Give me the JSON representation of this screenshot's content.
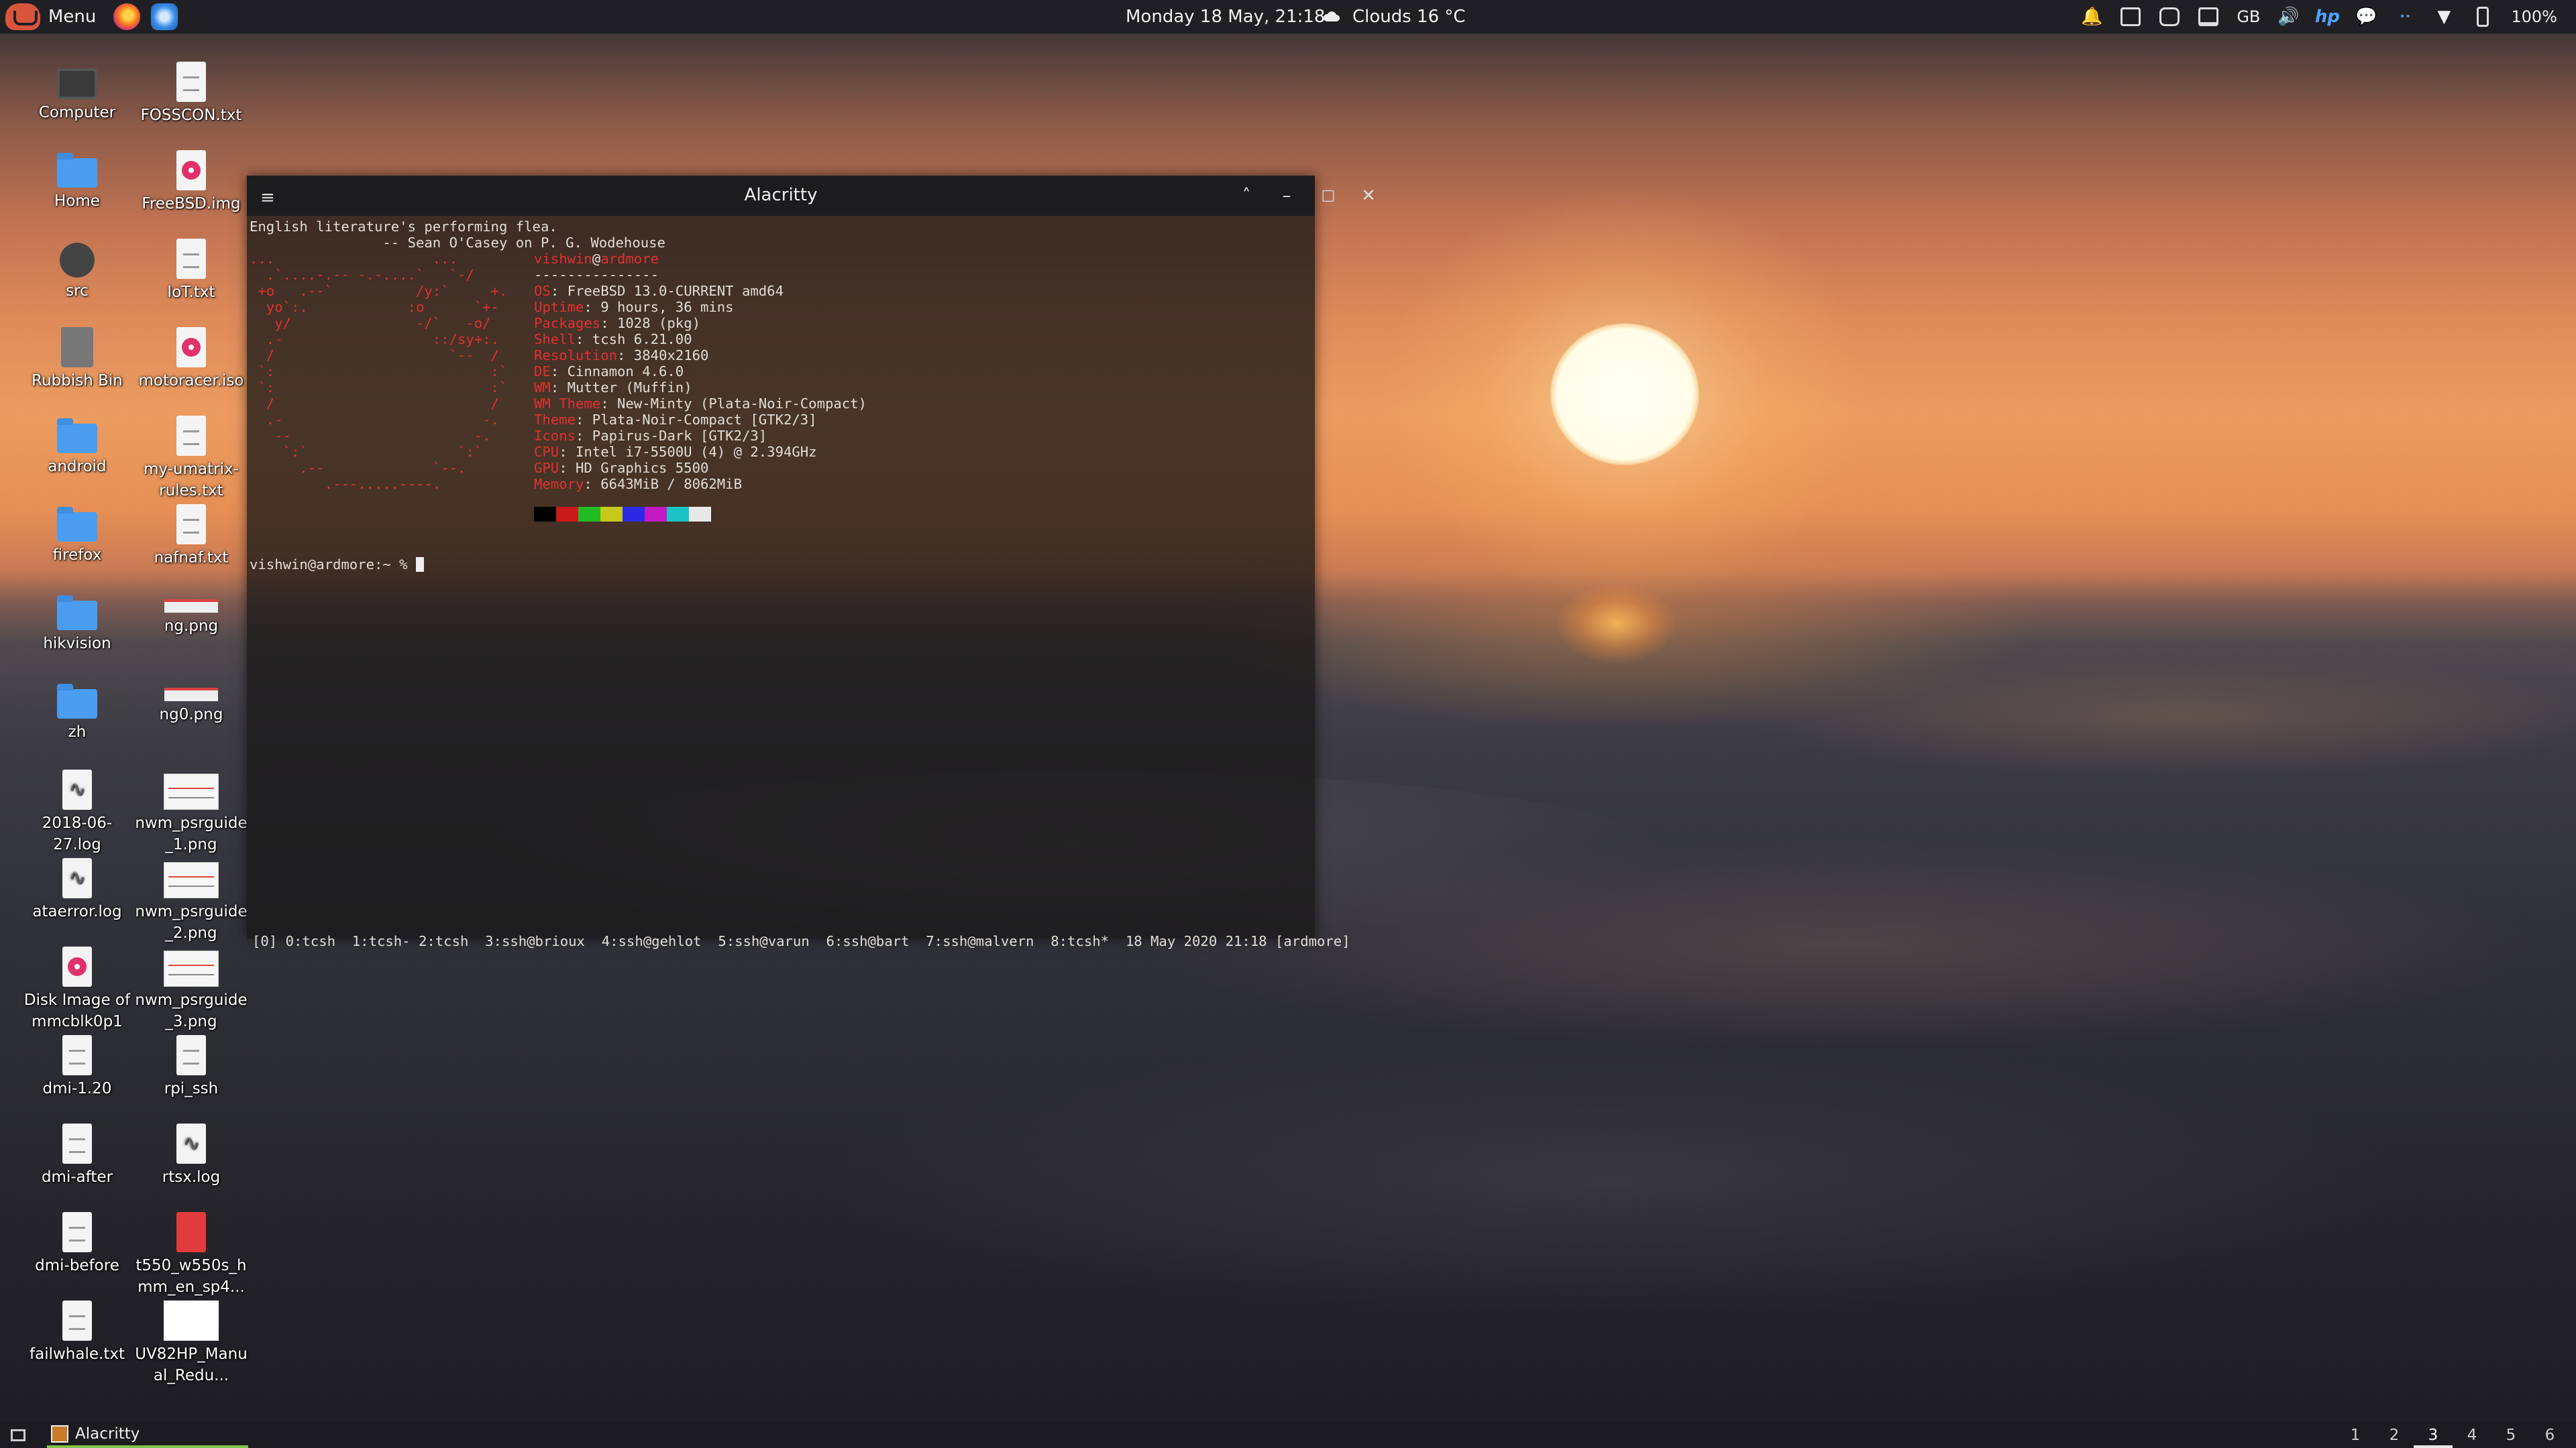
{
  "top_panel": {
    "menu_label": "Menu",
    "clock": "Monday 18 May, 21:18",
    "weather": "Clouds 16 °C",
    "keyboard_layout": "GB",
    "battery": "100%"
  },
  "desktop_icons": [
    {
      "label": "Computer",
      "type": "monitor"
    },
    {
      "label": "FOSSCON.txt",
      "type": "doc"
    },
    {
      "label": "Home",
      "type": "folder"
    },
    {
      "label": "FreeBSD.img",
      "type": "disc"
    },
    {
      "label": "src",
      "type": "hdd"
    },
    {
      "label": "IoT.txt",
      "type": "doc"
    },
    {
      "label": "Rubbish Bin",
      "type": "trash"
    },
    {
      "label": "motoracer.iso",
      "type": "disc"
    },
    {
      "label": "android",
      "type": "folder"
    },
    {
      "label": "my-umatrix-rules.txt",
      "type": "doc"
    },
    {
      "label": "firefox",
      "type": "folder"
    },
    {
      "label": "nafnaf.txt",
      "type": "doc"
    },
    {
      "label": "hikvision",
      "type": "folder"
    },
    {
      "label": "ng.png",
      "type": "strip"
    },
    {
      "label": "zh",
      "type": "folder"
    },
    {
      "label": "ng0.png",
      "type": "strip"
    },
    {
      "label": "2018-06-27.log",
      "type": "log"
    },
    {
      "label": "nwm_psrguide_1.png",
      "type": "thumb"
    },
    {
      "label": "ataerror.log",
      "type": "log"
    },
    {
      "label": "nwm_psrguide_2.png",
      "type": "thumb"
    },
    {
      "label": "Disk Image of mmcblk0p1 (...",
      "type": "disc"
    },
    {
      "label": "nwm_psrguide_3.png",
      "type": "thumb"
    },
    {
      "label": "dmi-1.20",
      "type": "doc"
    },
    {
      "label": "rpi_ssh",
      "type": "doc"
    },
    {
      "label": "dmi-after",
      "type": "doc"
    },
    {
      "label": "rtsx.log",
      "type": "log"
    },
    {
      "label": "dmi-before",
      "type": "doc"
    },
    {
      "label": "t550_w550s_hmm_en_sp4...",
      "type": "pdf"
    },
    {
      "label": "failwhale.txt",
      "type": "doc"
    },
    {
      "label": "UV82HP_Manual_Redu...",
      "type": "white"
    }
  ],
  "window": {
    "title": "Alacritty",
    "lines": [
      "English literature's performing flea.",
      "                -- Sean O'Casey on P. G. Wodehouse"
    ],
    "ascii_logo": [
      "...                   ...",
      "  .`....-.-- -.-....`   `-/",
      " +o   .--`          /y:`     +.",
      "  yo`:.            :o      `+-",
      "   y/               -/`   -o/",
      "  .-                  ::/sy+:.",
      "  /                     `--  /",
      " `:                          :`",
      " `:                          :`",
      "  /                          /",
      "  .-                        -.",
      "   --                      -.",
      "    `:`                  `:`",
      "      .--             `--.",
      "         .---.....----."
    ],
    "user": "vishwin",
    "host": "ardmore",
    "separator": "---------------",
    "info": [
      {
        "key": "OS",
        "value": ": FreeBSD 13.0-CURRENT amd64"
      },
      {
        "key": "Uptime",
        "value": ": 9 hours, 36 mins"
      },
      {
        "key": "Packages",
        "value": ": 1028 (pkg)"
      },
      {
        "key": "Shell",
        "value": ": tcsh 6.21.00"
      },
      {
        "key": "Resolution",
        "value": ": 3840x2160"
      },
      {
        "key": "DE",
        "value": ": Cinnamon 4.6.0"
      },
      {
        "key": "WM",
        "value": ": Mutter (Muffin)"
      },
      {
        "key": "WM Theme",
        "value": ": New-Minty (Plata-Noir-Compact)"
      },
      {
        "key": "Theme",
        "value": ": Plata-Noir-Compact [GTK2/3]"
      },
      {
        "key": "Icons",
        "value": ": Papirus-Dark [GTK2/3]"
      },
      {
        "key": "CPU",
        "value": ": Intel i7-5500U (4) @ 2.394GHz"
      },
      {
        "key": "GPU",
        "value": ": HD Graphics 5500"
      },
      {
        "key": "Memory",
        "value": ": 6643MiB / 8062MiB"
      }
    ],
    "palette": [
      "#000000",
      "#cc1a1a",
      "#22bb22",
      "#c8c81a",
      "#2a2ae6",
      "#c41ac4",
      "#1ac4c4",
      "#e8e8e8"
    ],
    "prompt": "vishwin@ardmore:~ % ",
    "tmux_status": "[0] 0:tcsh  1:tcsh- 2:tcsh  3:ssh@brioux  4:ssh@gehlot  5:ssh@varun  6:ssh@bart  7:ssh@malvern  8:tcsh*  18 May 2020 21:18 [ardmore]"
  },
  "bottom_panel": {
    "task_label": "Alacritty",
    "workspaces": [
      "1",
      "2",
      "3",
      "4",
      "5",
      "6"
    ],
    "active_workspace": "3"
  }
}
